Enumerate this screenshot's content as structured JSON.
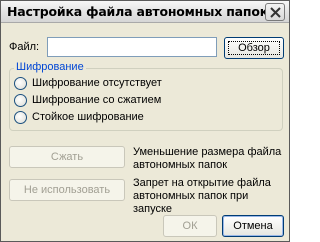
{
  "dialog": {
    "title": "Настройка файла автономных папок"
  },
  "file_row": {
    "label": "Файл:",
    "value": "",
    "browse_label": "Обзор"
  },
  "encryption": {
    "group_label": "Шифрование",
    "options": [
      {
        "label": "Шифрование отсутствует",
        "selected": false
      },
      {
        "label": "Шифрование со сжатием",
        "selected": false
      },
      {
        "label": "Стойкое шифрование",
        "selected": false
      }
    ]
  },
  "actions": {
    "compress_label": "Сжать",
    "compress_desc": "Уменьшение размера файла автономных папок",
    "noauto_label": "Не использовать",
    "noauto_desc": "Запрет на открытие файла автономных папок при запуске"
  },
  "footer": {
    "ok_label": "ОК",
    "cancel_label": "Отмена"
  },
  "colors": {
    "accent": "#0046d5",
    "dialog_bg": "#ece9d8"
  }
}
